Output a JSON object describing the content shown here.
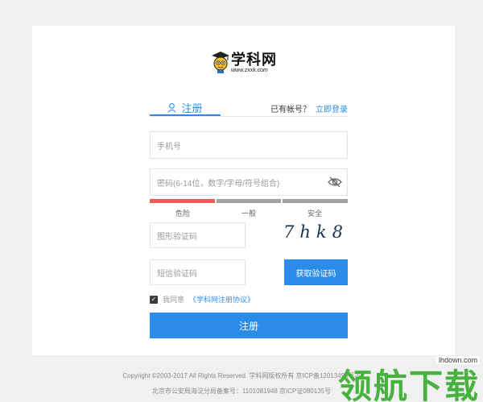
{
  "logo": {
    "name": "学科网",
    "url": "www.zxxk.com",
    "icon": "graduate-mascot-icon"
  },
  "tabs": {
    "register_label": "注册",
    "have_account": "已有帐号？",
    "login_link": "立即登录"
  },
  "form": {
    "phone_placeholder": "手机号",
    "password_placeholder": "密码(6-14位，数字/字母/符号组合)",
    "strength_labels": [
      "危险",
      "一般",
      "安全"
    ],
    "image_code_placeholder": "图形验证码",
    "captcha_text": "7hk8",
    "sms_code_placeholder": "短信验证码",
    "get_code_button": "获取验证码",
    "agree_text": "我同意",
    "agreement_link": "《学科网注册协议》",
    "agree_checked": true,
    "submit_button": "注册"
  },
  "colors": {
    "accent": "#2b8ce8",
    "danger": "#f05a5a",
    "neutral_bar": "#a3a3a3"
  },
  "footer": {
    "line1": "Copyright ©2003-2017 All Rights Reserved. 学科网版权所有 京ICP备12013495号-5",
    "line2": "北京市公安局海淀分局备案号：1101081948 京ICP证080135号"
  },
  "watermark": {
    "text": "领航下载",
    "url": "lhdown.com"
  }
}
